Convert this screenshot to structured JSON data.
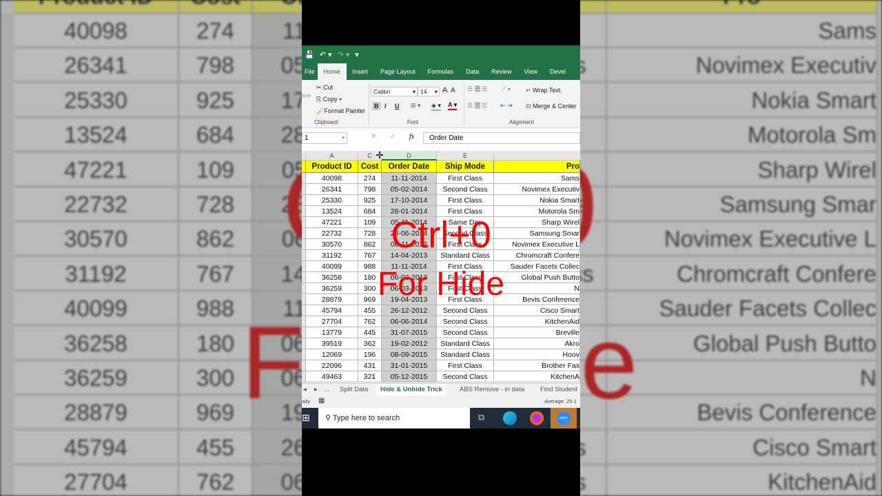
{
  "titlebar": {
    "save_icon": "save-icon",
    "undo_icon": "undo-icon",
    "redo_icon": "redo-icon"
  },
  "tabs": [
    "File",
    "Home",
    "Insert",
    "Page Layout",
    "Formulas",
    "Data",
    "Review",
    "View",
    "Devel"
  ],
  "ribbon": {
    "paste": "aste",
    "cut": "Cut",
    "copy": "Copy",
    "format_painter": "Format Painter",
    "clipboard": "Clipboard",
    "font_name": "Calibri",
    "font_size": "14",
    "bold": "B",
    "italic": "I",
    "underline": "U",
    "font_color": "A",
    "grow": "A",
    "shrink": "A",
    "font": "Font",
    "wrap_text": "Wrap Text",
    "merge_center": "Merge & Center",
    "alignment": "Alignment"
  },
  "formula_bar": {
    "name_box": "1",
    "fx": "fx",
    "value": "Order Date"
  },
  "column_headers": [
    "A",
    "C",
    "D",
    "E"
  ],
  "table": {
    "headers": [
      "Product ID",
      "Cost",
      "Order Date",
      "Ship Mode",
      "Pro"
    ],
    "rows": [
      [
        "40098",
        "274",
        "11-11-2014",
        "First Class",
        "Sams"
      ],
      [
        "26341",
        "798",
        "05-02-2014",
        "Second Class",
        "Novimex Executiv"
      ],
      [
        "25330",
        "925",
        "17-10-2014",
        "First Class",
        "Nokia Smart"
      ],
      [
        "13524",
        "684",
        "28-01-2014",
        "First Class",
        "Motorola Sm"
      ],
      [
        "47221",
        "109",
        "05-11-2014",
        "Same Day",
        "Sharp Wirel"
      ],
      [
        "22732",
        "728",
        "28-06-2014",
        "Second Class",
        "Samsung Smar"
      ],
      [
        "30570",
        "862",
        "06-11-2012",
        "First Class",
        "Novimex Executive L"
      ],
      [
        "31192",
        "767",
        "14-04-2013",
        "Standard Class",
        "Chromcraft Confere"
      ],
      [
        "40099",
        "988",
        "11-11-2014",
        "First Class",
        "Sauder Facets Collec"
      ],
      [
        "36258",
        "180",
        "06-03-2013",
        "First Class",
        "Global Push Butto"
      ],
      [
        "36259",
        "300",
        "06-03-2013",
        "First Class",
        "N"
      ],
      [
        "28879",
        "969",
        "19-04-2013",
        "First Class",
        "Bevis Conference"
      ],
      [
        "45794",
        "455",
        "26-12-2012",
        "Second Class",
        "Cisco Smart"
      ],
      [
        "27704",
        "762",
        "06-06-2014",
        "Second Class",
        "KitchenAid"
      ],
      [
        "13779",
        "445",
        "31-07-2015",
        "Second Class",
        "Breville"
      ],
      [
        "39519",
        "362",
        "19-02-2012",
        "Standard Class",
        "Akro"
      ],
      [
        "12069",
        "196",
        "08-09-2015",
        "Standard Class",
        "Hoov"
      ],
      [
        "22096",
        "431",
        "31-01-2015",
        "First Class",
        "Brother Fax"
      ],
      [
        "49463",
        "321",
        "05-12-2015",
        "Second Class",
        "KitchenA"
      ]
    ]
  },
  "sheet_tabs": {
    "more": "...",
    "tabs": [
      "Split Data",
      "Hide & Unhide Trick",
      "ABS Remove - in data",
      "Find Student"
    ],
    "active": "Hide & Unhide Trick"
  },
  "status": {
    "ready": "ady",
    "average": "Average: 25-1"
  },
  "taskbar": {
    "search_placeholder": "Type here to search",
    "zoom": "zoom"
  },
  "overlay": {
    "line1": "Ctrl+0",
    "line2": "For Hide",
    "color": "#ff0000"
  },
  "colors": {
    "excel_green": "#217346",
    "header_yellow": "#ffff00"
  }
}
